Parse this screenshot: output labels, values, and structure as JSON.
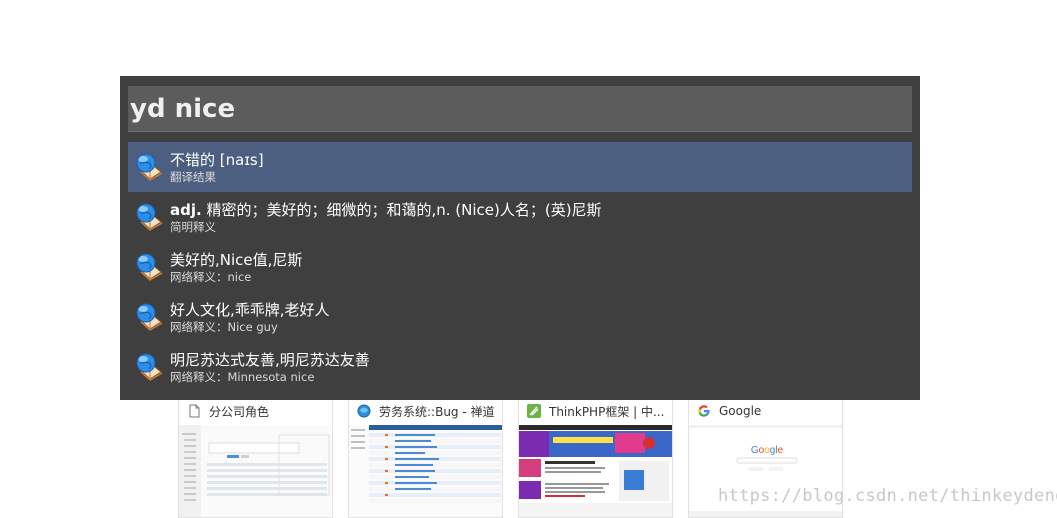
{
  "launcher": {
    "query": "yd nice",
    "results": [
      {
        "title": "不错的 [naɪs]",
        "subtitle": "翻译结果",
        "selected": true
      },
      {
        "title": "adj. 精密的；美好的；细微的；和蔼的,n. (Nice)人名；(英)尼斯",
        "subtitle": "简明释义",
        "selected": false
      },
      {
        "title": "美好的,Nice值,尼斯",
        "subtitle": "网络释义：nice",
        "selected": false
      },
      {
        "title": "好人文化,乖乖牌,老好人",
        "subtitle": "网络释义：Nice guy",
        "selected": false
      },
      {
        "title": "明尼苏达式友善,明尼苏达友善",
        "subtitle": "网络释义：Minnesota nice",
        "selected": false
      }
    ]
  },
  "browser_tiles": [
    {
      "title": "分公司角色",
      "icon": "page-icon"
    },
    {
      "title": "劳务系统::Bug - 禅道",
      "icon": "globe-icon"
    },
    {
      "title": "ThinkPHP框架 | 中...",
      "icon": "thinkphp-icon"
    },
    {
      "title": "Google",
      "icon": "google-icon"
    }
  ],
  "watermark": "https://blog.csdn.net/thinkeydeng",
  "colors": {
    "launcher_bg": "#3f3f3f",
    "query_bg": "#5c5c5c",
    "selected_row": "#4c5f80"
  }
}
